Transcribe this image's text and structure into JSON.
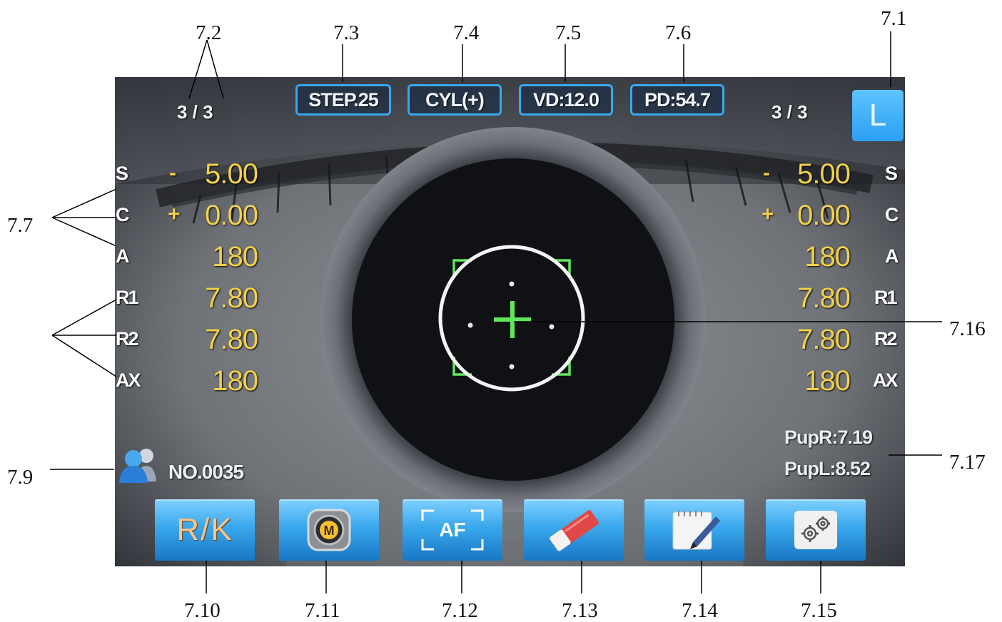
{
  "callouts": {
    "c7_1": "7.1",
    "c7_2": "7.2",
    "c7_3": "7.3",
    "c7_4": "7.4",
    "c7_4b": "7.4",
    "c7_5": "7.5",
    "c7_6": "7.6",
    "c7_7": "7.7",
    "c7_9": "7.9",
    "c7_10": "7.10",
    "c7_11": "7.11",
    "c7_12": "7.12",
    "c7_13": "7.13",
    "c7_14": "7.14",
    "c7_15": "7.15",
    "c7_16": "7.16",
    "c7_17": "7.17"
  },
  "header": {
    "left_page": "3 / 3",
    "right_page": "3 / 3",
    "step": "STEP.25",
    "cyl": "CYL(+)",
    "vd": "VD:12.0",
    "pd": "PD:54.7",
    "eye": "L"
  },
  "left_measure": {
    "s": {
      "label": "S",
      "sign": "-",
      "value": "5.00"
    },
    "c": {
      "label": "C",
      "sign": "+",
      "value": "0.00"
    },
    "a": {
      "label": "A",
      "value": "180"
    },
    "r1": {
      "label": "R1",
      "value": "7.80"
    },
    "r2": {
      "label": "R2",
      "value": "7.80"
    },
    "ax": {
      "label": "AX",
      "value": "180"
    }
  },
  "right_measure": {
    "s": {
      "label": "S",
      "sign": "-",
      "value": "5.00"
    },
    "c": {
      "label": "C",
      "sign": "+",
      "value": "0.00"
    },
    "a": {
      "label": "A",
      "value": "180"
    },
    "r1": {
      "label": "R1",
      "value": "7.80"
    },
    "r2": {
      "label": "R2",
      "value": "7.80"
    },
    "ax": {
      "label": "AX",
      "value": "180"
    }
  },
  "pupil": {
    "pupr": "PupR:7.19",
    "pupl": "PupL:8.52"
  },
  "patient": {
    "number": "NO.0035"
  },
  "toolbar": {
    "rk": "R/K",
    "m": "M",
    "af": "AF"
  },
  "colors": {
    "accent": "#3aa8ec",
    "value_yellow": "#f2d04a",
    "target_green": "#5ee85a"
  }
}
